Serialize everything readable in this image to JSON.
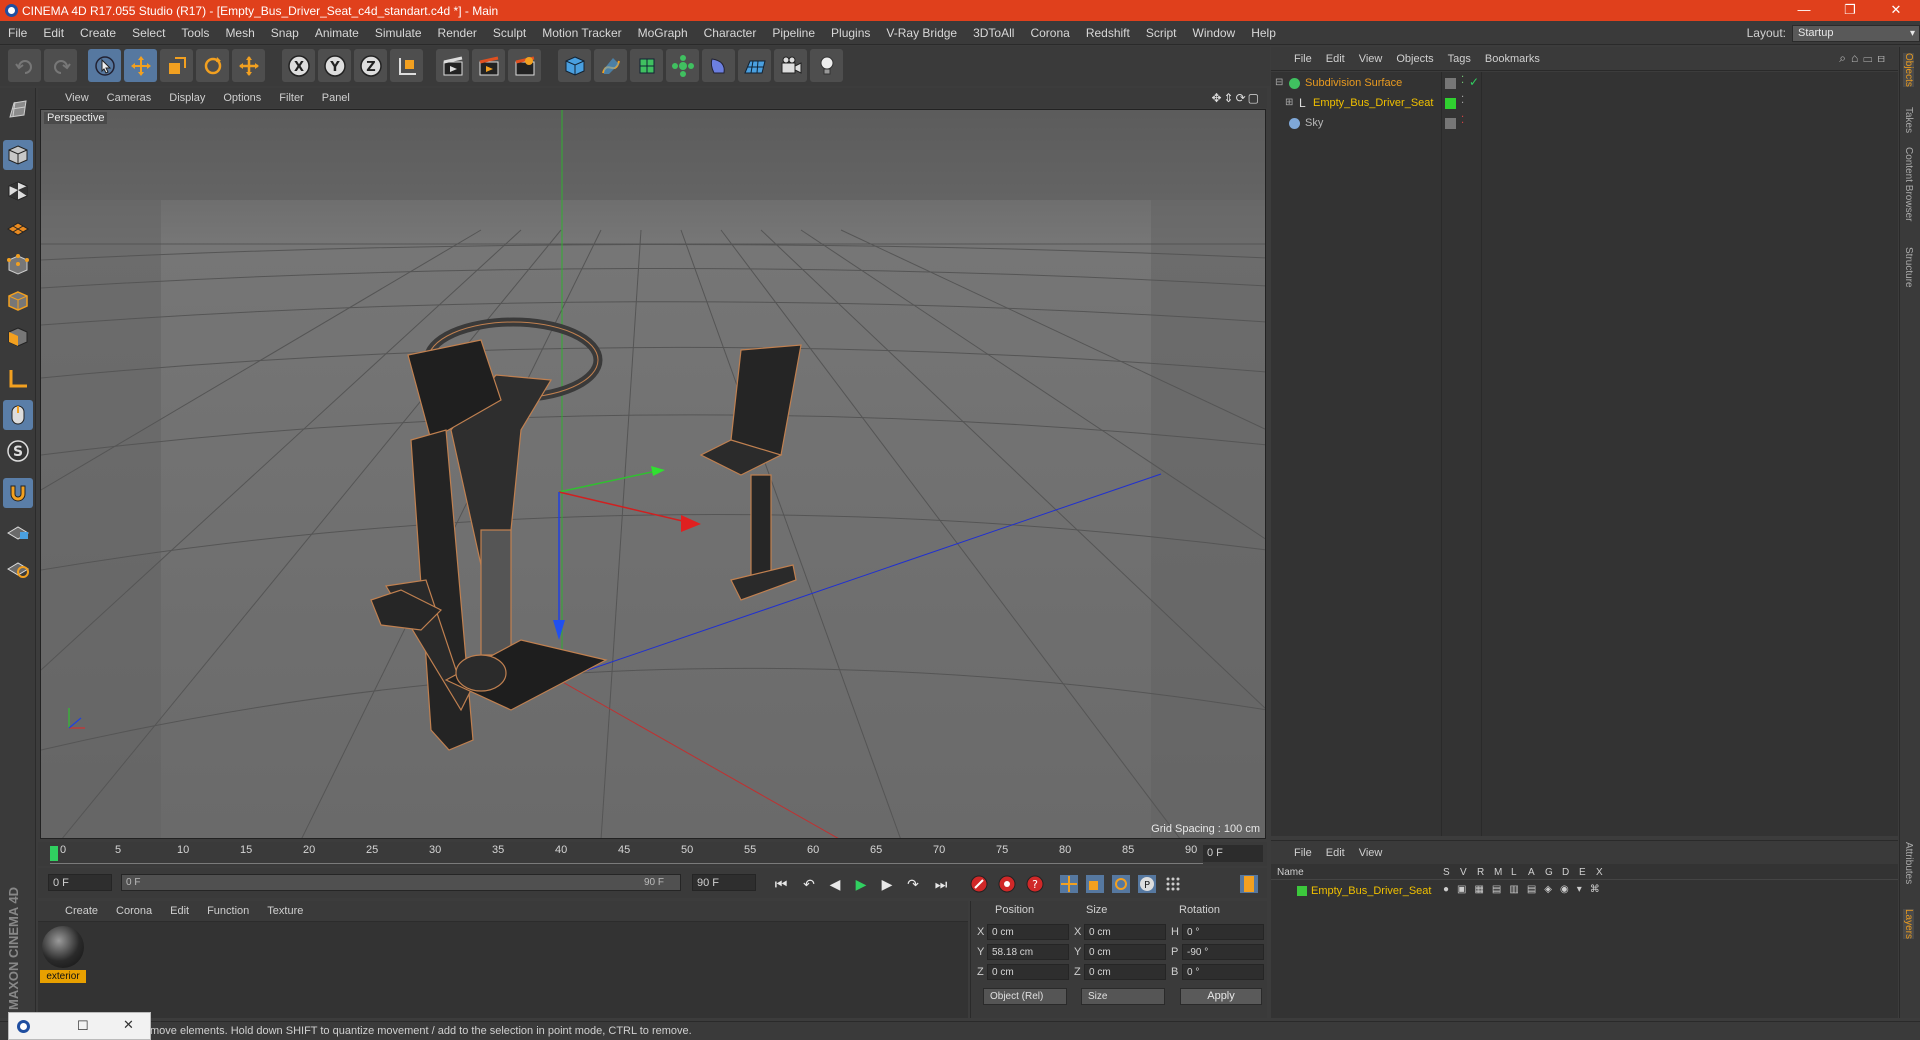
{
  "titlebar": {
    "title": "CINEMA 4D R17.055 Studio (R17) - [Empty_Bus_Driver_Seat_c4d_standart.c4d *] - Main",
    "minimize": "—",
    "restore": "❐",
    "close": "✕"
  },
  "menubar": {
    "items": [
      "File",
      "Edit",
      "Create",
      "Select",
      "Tools",
      "Mesh",
      "Snap",
      "Animate",
      "Simulate",
      "Render",
      "Sculpt",
      "Motion Tracker",
      "MoGraph",
      "Character",
      "Pipeline",
      "Plugins",
      "V-Ray Bridge",
      "3DToAll",
      "Corona",
      "Redshift",
      "Script",
      "Window",
      "Help"
    ],
    "layout_label": "Layout:",
    "layout_value": "Startup"
  },
  "viewport": {
    "menu": [
      "View",
      "Cameras",
      "Display",
      "Options",
      "Filter",
      "Panel"
    ],
    "camera_label": "Perspective",
    "grid_spacing": "Grid Spacing : 100 cm"
  },
  "timeline": {
    "ticks": [
      "0",
      "5",
      "10",
      "15",
      "20",
      "25",
      "30",
      "35",
      "40",
      "45",
      "50",
      "55",
      "60",
      "65",
      "70",
      "75",
      "80",
      "85",
      "90"
    ],
    "current_frame": "0 F"
  },
  "transport": {
    "start_field": "0 F",
    "range_start": "0 F",
    "range_end": "90 F",
    "end_field": "90 F"
  },
  "materials": {
    "menu": [
      "Create",
      "Corona",
      "Edit",
      "Function",
      "Texture"
    ],
    "items": [
      {
        "name": "exterior"
      }
    ]
  },
  "coordinates": {
    "headers": {
      "position": "Position",
      "size": "Size",
      "rotation": "Rotation"
    },
    "rows": [
      {
        "axis": "X",
        "pos": "0 cm",
        "size_axis": "X",
        "size": "0 cm",
        "rot_axis": "H",
        "rot": "0 °"
      },
      {
        "axis": "Y",
        "pos": "58.18 cm",
        "size_axis": "Y",
        "size": "0 cm",
        "rot_axis": "P",
        "rot": "-90 °"
      },
      {
        "axis": "Z",
        "pos": "0 cm",
        "size_axis": "Z",
        "size": "0 cm",
        "rot_axis": "B",
        "rot": "0 °"
      }
    ],
    "mode_dropdown": "Object (Rel)",
    "size_dropdown": "Size",
    "apply": "Apply"
  },
  "object_manager": {
    "menu": [
      "File",
      "Edit",
      "View",
      "Objects",
      "Tags",
      "Bookmarks"
    ],
    "objects": [
      {
        "name": "Subdivision Surface",
        "color": "#e89a20"
      },
      {
        "name": "Empty_Bus_Driver_Seat",
        "color": "#f0c000"
      },
      {
        "name": "Sky",
        "color": "#b8b8b8"
      }
    ]
  },
  "layer_manager": {
    "menu": [
      "File",
      "Edit",
      "View"
    ],
    "columns": [
      "Name",
      "S",
      "V",
      "R",
      "M",
      "L",
      "A",
      "G",
      "D",
      "E",
      "X"
    ],
    "row_name": "Empty_Bus_Driver_Seat",
    "row_color": "#3cc83c"
  },
  "right_tabs": [
    "Objects",
    "Takes",
    "Content Browser",
    "Structure",
    "Attributes",
    "Layers"
  ],
  "statusbar": {
    "text": "move elements. Hold down SHIFT to quantize movement / add to the selection in point mode, CTRL to remove."
  },
  "branding": {
    "text": "MAXON CINEMA 4D"
  },
  "colors": {
    "title_bar": "#e0401c",
    "active_tool": "#5678a0",
    "selected_object": "#e89a20",
    "x_axis": "#d03030",
    "y_axis": "#30c030",
    "z_axis": "#2040e0"
  }
}
